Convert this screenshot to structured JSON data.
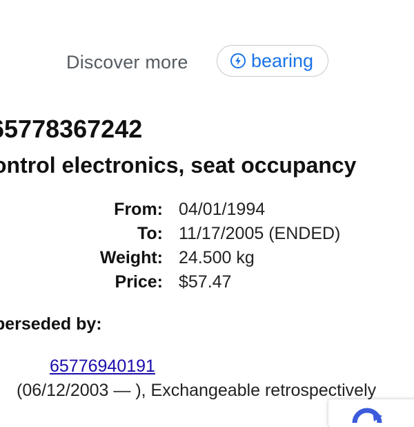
{
  "discover": {
    "label": "Discover more",
    "chip_label": "bearing",
    "chip_icon": "bolt-circle-icon"
  },
  "part": {
    "number": "65778367242",
    "title": "ontrol electronics, seat occupancy"
  },
  "details": {
    "from_key": "From:",
    "from_value": "04/01/1994",
    "to_key": "To:",
    "to_value": "11/17/2005 (ENDED)",
    "weight_key": "Weight:",
    "weight_value": "24.500 kg",
    "price_key": "Price:",
    "price_value": "$57.47"
  },
  "superseded": {
    "heading": "perseded by:",
    "link": "65776940191",
    "note": "(06/12/2003 — ), Exchangeable retrospectively"
  },
  "colors": {
    "accent": "#1a73e8",
    "link": "#1a0dab",
    "muted": "#555b61"
  }
}
